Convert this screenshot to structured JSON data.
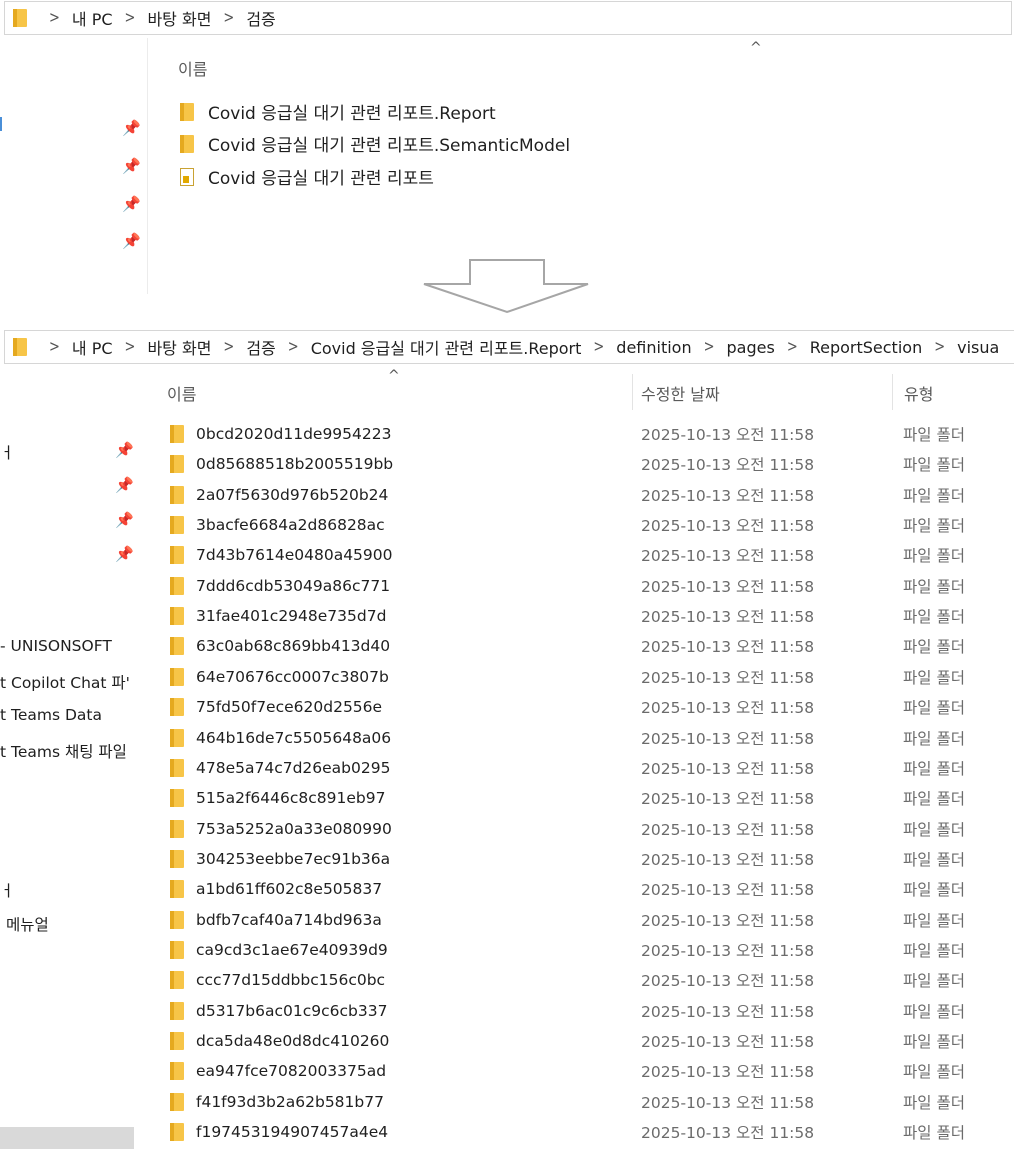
{
  "top_window": {
    "breadcrumb": [
      "내 PC",
      "바탕 화면",
      "검증"
    ],
    "column_header": "이름",
    "items": [
      {
        "name": "Covid 응급실 대기 관련 리포트.Report",
        "icon": "folder-icon"
      },
      {
        "name": "Covid 응급실 대기 관련 리포트.SemanticModel",
        "icon": "folder-icon"
      },
      {
        "name": "Covid 응급실 대기 관련 리포트",
        "icon": "pbip-file-icon"
      }
    ]
  },
  "bottom_window": {
    "breadcrumb": [
      "내 PC",
      "바탕 화면",
      "검증",
      "Covid 응급실 대기 관련 리포트.Report",
      "definition",
      "pages",
      "ReportSection",
      "visua"
    ],
    "columns": {
      "name": "이름",
      "modified": "수정한 날짜",
      "type": "유형"
    },
    "sidebar_items": [
      "- UNISONSOFT",
      "t Copilot Chat 파'",
      "t Teams Data",
      "t Teams 채팅 파일",
      "ㅓ",
      "메뉴얼",
      "ㅓ"
    ],
    "rows": [
      {
        "name": "0bcd2020d11de9954223",
        "date": "2025-10-13 오전 11:58",
        "type": "파일 폴더"
      },
      {
        "name": "0d85688518b2005519bb",
        "date": "2025-10-13 오전 11:58",
        "type": "파일 폴더"
      },
      {
        "name": "2a07f5630d976b520b24",
        "date": "2025-10-13 오전 11:58",
        "type": "파일 폴더"
      },
      {
        "name": "3bacfe6684a2d86828ac",
        "date": "2025-10-13 오전 11:58",
        "type": "파일 폴더"
      },
      {
        "name": "7d43b7614e0480a45900",
        "date": "2025-10-13 오전 11:58",
        "type": "파일 폴더"
      },
      {
        "name": "7ddd6cdb53049a86c771",
        "date": "2025-10-13 오전 11:58",
        "type": "파일 폴더"
      },
      {
        "name": "31fae401c2948e735d7d",
        "date": "2025-10-13 오전 11:58",
        "type": "파일 폴더"
      },
      {
        "name": "63c0ab68c869bb413d40",
        "date": "2025-10-13 오전 11:58",
        "type": "파일 폴더"
      },
      {
        "name": "64e70676cc0007c3807b",
        "date": "2025-10-13 오전 11:58",
        "type": "파일 폴더"
      },
      {
        "name": "75fd50f7ece620d2556e",
        "date": "2025-10-13 오전 11:58",
        "type": "파일 폴더"
      },
      {
        "name": "464b16de7c5505648a06",
        "date": "2025-10-13 오전 11:58",
        "type": "파일 폴더"
      },
      {
        "name": "478e5a74c7d26eab0295",
        "date": "2025-10-13 오전 11:58",
        "type": "파일 폴더"
      },
      {
        "name": "515a2f6446c8c891eb97",
        "date": "2025-10-13 오전 11:58",
        "type": "파일 폴더"
      },
      {
        "name": "753a5252a0a33e080990",
        "date": "2025-10-13 오전 11:58",
        "type": "파일 폴더"
      },
      {
        "name": "304253eebbe7ec91b36a",
        "date": "2025-10-13 오전 11:58",
        "type": "파일 폴더"
      },
      {
        "name": "a1bd61ff602c8e505837",
        "date": "2025-10-13 오전 11:58",
        "type": "파일 폴더"
      },
      {
        "name": "bdfb7caf40a714bd963a",
        "date": "2025-10-13 오전 11:58",
        "type": "파일 폴더"
      },
      {
        "name": "ca9cd3c1ae67e40939d9",
        "date": "2025-10-13 오전 11:58",
        "type": "파일 폴더"
      },
      {
        "name": "ccc77d15ddbbc156c0bc",
        "date": "2025-10-13 오전 11:58",
        "type": "파일 폴더"
      },
      {
        "name": "d5317b6ac01c9c6cb337",
        "date": "2025-10-13 오전 11:58",
        "type": "파일 폴더"
      },
      {
        "name": "dca5da48e0d8dc410260",
        "date": "2025-10-13 오전 11:58",
        "type": "파일 폴더"
      },
      {
        "name": "ea947fce7082003375ad",
        "date": "2025-10-13 오전 11:58",
        "type": "파일 폴더"
      },
      {
        "name": "f41f93d3b2a62b581b77",
        "date": "2025-10-13 오전 11:58",
        "type": "파일 폴더"
      },
      {
        "name": "f197453194907457a4e4",
        "date": "2025-10-13 오전 11:58",
        "type": "파일 폴더"
      }
    ]
  },
  "colors": {
    "folder": "#f7c548",
    "folder_dark": "#e5a91f",
    "border": "#d6d6d6",
    "muted_text": "#6b6b6b"
  }
}
